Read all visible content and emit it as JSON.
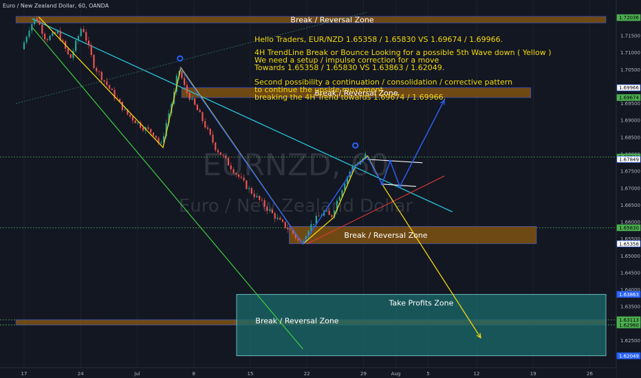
{
  "chart_data": {
    "type": "candlestick",
    "title": "Euro / New Zealand Dollar, 60, OANDA",
    "watermark": {
      "symbol": "EURNZD, 60",
      "name": "Euro / New Zealand Dollar"
    },
    "ylim": [
      1.6185,
      1.7215
    ],
    "x_ticks": [
      {
        "day": 0,
        "label": "17"
      },
      {
        "day": 7,
        "label": "24"
      },
      {
        "day": 14,
        "label": "Jul"
      },
      {
        "day": 21,
        "label": "8"
      },
      {
        "day": 28,
        "label": "15"
      },
      {
        "day": 35,
        "label": "22"
      },
      {
        "day": 42,
        "label": "29"
      },
      {
        "day": 46,
        "label": "Aug"
      },
      {
        "day": 50,
        "label": "5"
      },
      {
        "day": 56,
        "label": "12"
      },
      {
        "day": 63,
        "label": "19"
      },
      {
        "day": 70,
        "label": "26"
      }
    ],
    "y_ticks": [
      1.725,
      1.72,
      1.715,
      1.71,
      1.705,
      1.7,
      1.695,
      1.69,
      1.685,
      1.68,
      1.675,
      1.67,
      1.665,
      1.66,
      1.655,
      1.65,
      1.645,
      1.64,
      1.635,
      1.63,
      1.625
    ],
    "price_tags": [
      {
        "value": 1.72036,
        "label": "1.72036",
        "kind": "green"
      },
      {
        "value": 1.72757,
        "label": "1.72757",
        "kind": "green"
      },
      {
        "value": 1.69966,
        "label": "1.69966",
        "kind": "white"
      },
      {
        "value": 1.69674,
        "label": "1.69674",
        "kind": "green"
      },
      {
        "value": 1.67918,
        "label": "1.67918",
        "kind": "green"
      },
      {
        "value": 1.67849,
        "label": "1.67849",
        "kind": "white"
      },
      {
        "value": 1.6583,
        "label": "1.65830",
        "kind": "green"
      },
      {
        "value": 1.65358,
        "label": "1.65358",
        "kind": "white"
      },
      {
        "value": 1.63863,
        "label": "1.63863",
        "kind": "blue"
      },
      {
        "value": 1.63113,
        "label": "1.63113",
        "kind": "green"
      },
      {
        "value": 1.6296,
        "label": "1.62960",
        "kind": "green"
      },
      {
        "value": 1.62049,
        "label": "1.62049",
        "kind": "blue"
      }
    ],
    "zones": [
      {
        "label": "Break / Reversal Zone",
        "x_start": -1,
        "x_end": 72,
        "y_top": 1.7207,
        "y_bottom": 1.7188
      },
      {
        "label": "Break / Reversal Zone",
        "x_start": 19.5,
        "x_end": 62.7,
        "y_top": 1.69966,
        "y_bottom": 1.69674
      },
      {
        "label": "Break / Reversal Zone",
        "x_start": 32.8,
        "x_end": 63.4,
        "y_top": 1.6587,
        "y_bottom": 1.65358
      },
      {
        "label": "Break / Reversal Zone",
        "x_start": -1,
        "x_end": 72,
        "y_top": 1.63113,
        "y_bottom": 1.6296
      },
      {
        "label": "Take Profits Zone",
        "x_start": 26.3,
        "x_end": 72,
        "y_top": 1.63863,
        "y_bottom": 1.62049
      }
    ],
    "levels": [
      {
        "value": 1.67918,
        "color": "#4caf50"
      },
      {
        "value": 1.6583,
        "color": "#4caf50"
      },
      {
        "value": 1.63113,
        "color": "#4caf50"
      },
      {
        "value": 1.6296,
        "color": "#4caf50"
      }
    ],
    "lines": [
      {
        "from": [
          1.0,
          1.72
        ],
        "to": [
          53.0,
          1.663
        ],
        "color": "#26c6da",
        "width": 1.3
      },
      {
        "from": [
          1.0,
          1.7175
        ],
        "to": [
          34.5,
          1.6225
        ],
        "color": "#3fcf3f",
        "width": 1.2
      },
      {
        "from": [
          -1.0,
          1.695
        ],
        "to": [
          42.5,
          1.722
        ],
        "color": "#2e7d5b",
        "width": 0.8,
        "dash": true
      },
      {
        "from": [
          35.0,
          1.6535
        ],
        "to": [
          52.0,
          1.6736
        ],
        "color": "#e53935",
        "width": 1.1
      },
      {
        "from": [
          42.5,
          1.6785
        ],
        "to": [
          49.3,
          1.6775
        ],
        "color": "#ffffff",
        "width": 1.1
      },
      {
        "from": [
          44.3,
          1.6712
        ],
        "to": [
          48.5,
          1.6705
        ],
        "color": "#ffffff",
        "width": 1.1
      }
    ],
    "yellow_path": [
      [
        1.8,
        1.7206
      ],
      [
        17.2,
        1.682
      ],
      [
        19.4,
        1.7056
      ],
      [
        34.5,
        1.6535
      ],
      [
        38.3,
        1.6613
      ],
      [
        41.0,
        1.6765
      ],
      [
        42.5,
        1.6795
      ],
      [
        44.3,
        1.6712
      ],
      [
        56.5,
        1.6258
      ]
    ],
    "blue_path": [
      [
        19.3,
        1.7056
      ],
      [
        34.5,
        1.6535
      ],
      [
        41.0,
        1.6765
      ],
      [
        42.5,
        1.6792
      ],
      [
        44.3,
        1.6712
      ],
      [
        45.3,
        1.678
      ],
      [
        46.5,
        1.6705
      ],
      [
        52.0,
        1.696
      ]
    ],
    "markers": [
      {
        "day": 19.3,
        "value": 1.7083
      },
      {
        "day": 41.0,
        "value": 1.6826
      }
    ],
    "price_path": [
      [
        0,
        1.711
      ],
      [
        1,
        1.7175
      ],
      [
        1.8,
        1.7206
      ],
      [
        3,
        1.714
      ],
      [
        4.5,
        1.716
      ],
      [
        6,
        1.708
      ],
      [
        7.5,
        1.718
      ],
      [
        9,
        1.706
      ],
      [
        11,
        1.699
      ],
      [
        13,
        1.692
      ],
      [
        15,
        1.688
      ],
      [
        16.5,
        1.686
      ],
      [
        17.2,
        1.682
      ],
      [
        18,
        1.69
      ],
      [
        19,
        1.699
      ],
      [
        19.4,
        1.7056
      ],
      [
        20.3,
        1.699
      ],
      [
        22,
        1.692
      ],
      [
        24,
        1.682
      ],
      [
        26,
        1.676
      ],
      [
        28,
        1.67
      ],
      [
        30,
        1.665
      ],
      [
        32,
        1.66
      ],
      [
        33.5,
        1.657
      ],
      [
        34.5,
        1.6535
      ],
      [
        35.5,
        1.658
      ],
      [
        36.5,
        1.661
      ],
      [
        37.5,
        1.663
      ],
      [
        38.3,
        1.6613
      ],
      [
        39,
        1.666
      ],
      [
        40,
        1.672
      ],
      [
        41,
        1.6765
      ],
      [
        42,
        1.678
      ],
      [
        42.5,
        1.6795
      ]
    ],
    "annotations": [
      "Hello Traders, EUR/NZD 1.65358 / 1.65830 VS 1.69674 / 1.69966.",
      "4H TrendLine Break or Bounce Looking for a possible 5th Wave down ( Yellow )",
      "We need a setup / impulse correction for a move",
      "Towards 1.65358 / 1.65830 VS 1.63863 / 1.62049.",
      "Second possibility a continuation / consolidation / corrective pattern",
      "to continue the upside movement",
      " breaking the 4H Trend towards 1.69674 / 1.69966."
    ]
  },
  "colors": {
    "background": "#131722",
    "zone_brown": "#7a4f13",
    "zone_teal": "#1b6b6b",
    "yellow": "#f5d90a",
    "blue": "#2962ff",
    "bull": "#26a69a",
    "bear": "#ef5350"
  }
}
